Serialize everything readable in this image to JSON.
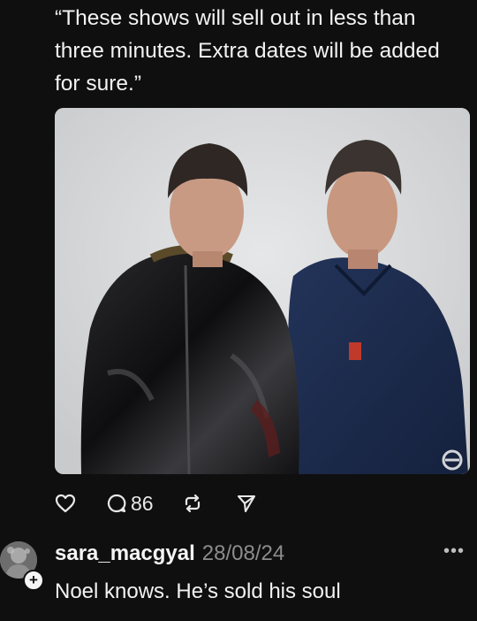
{
  "post": {
    "text": "“These shows will sell out in less than three minutes. Extra dates will be added for sure.”",
    "image_alt": "Two men posing against a grey background"
  },
  "actions": {
    "like_icon": "heart-icon",
    "reply_icon": "comment-icon",
    "reply_count": "86",
    "repost_icon": "repost-icon",
    "share_icon": "send-icon"
  },
  "comment": {
    "username": "sara_macgyal",
    "date": "28/08/24",
    "text": "Noel knows. He’s sold his soul",
    "more_label": "•••",
    "follow_badge": "+"
  },
  "colors": {
    "background": "#0f0f0f",
    "text": "#f2f2f2",
    "muted": "#8c8c8c"
  }
}
